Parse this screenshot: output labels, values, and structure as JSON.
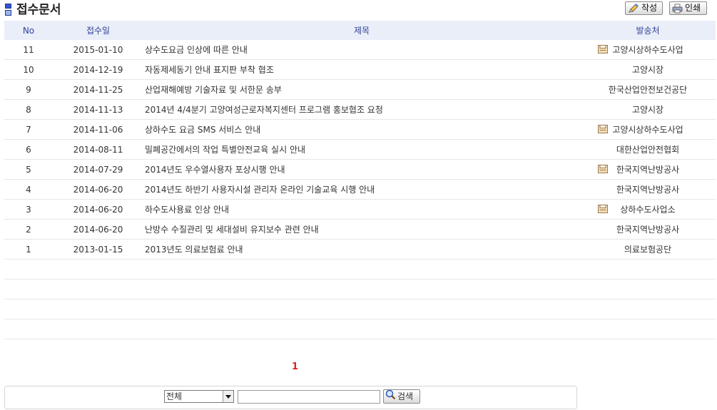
{
  "header": {
    "title": "접수문서",
    "write_label": "작성",
    "print_label": "인쇄"
  },
  "table": {
    "columns": [
      "No",
      "접수일",
      "제목",
      "발송처"
    ],
    "rows": [
      {
        "no": "11",
        "date": "2015-01-10",
        "subject": "상수도요금 인상에 따른 안내",
        "sender": "고양시상하수도사업",
        "attachment": true
      },
      {
        "no": "10",
        "date": "2014-12-19",
        "subject": "자동제세동기 안내 표지판 부착 협조",
        "sender": "고양시장",
        "attachment": false
      },
      {
        "no": "9",
        "date": "2014-11-25",
        "subject": "산업재해예방 기술자료 및 서한문 송부",
        "sender": "한국산업안전보건공단",
        "attachment": false
      },
      {
        "no": "8",
        "date": "2014-11-13",
        "subject": "2014년 4/4분기 고양여성근로자복지센터 프로그램 홍보협조 요청",
        "sender": "고양시장",
        "attachment": false
      },
      {
        "no": "7",
        "date": "2014-11-06",
        "subject": "상하수도 요금 SMS 서비스 안내",
        "sender": "고양시상하수도사업",
        "attachment": true
      },
      {
        "no": "6",
        "date": "2014-08-11",
        "subject": "밀폐공간에서의 작업 특별안전교육 실시 안내",
        "sender": "대한산업안전협회",
        "attachment": false
      },
      {
        "no": "5",
        "date": "2014-07-29",
        "subject": "2014년도 우수열사용자 포상시행 안내",
        "sender": "한국지역난방공사",
        "attachment": true
      },
      {
        "no": "4",
        "date": "2014-06-20",
        "subject": "2014년도 하반기 사용자시설 관리자 온라인 기술교육 시행 안내",
        "sender": "한국지역난방공사",
        "attachment": false
      },
      {
        "no": "3",
        "date": "2014-06-20",
        "subject": "하수도사용료 인상 안내",
        "sender": "상하수도사업소",
        "attachment": true
      },
      {
        "no": "2",
        "date": "2014-06-20",
        "subject": "난방수 수질관리 및 세대설비 유지보수 관련 안내",
        "sender": "한국지역난방공사",
        "attachment": false
      },
      {
        "no": "1",
        "date": "2013-01-15",
        "subject": "2013년도 의료보험료 안내",
        "sender": "의료보험공단",
        "attachment": false
      }
    ],
    "empty_rows": 4
  },
  "pagination": {
    "current_page": "1"
  },
  "search": {
    "scope_selected": "전체",
    "query_value": "",
    "button_label": "검색"
  },
  "colors": {
    "header_bg": "#e9eef8",
    "header_text": "#30429a",
    "current_page": "#e02020",
    "title_mark": "#3355cc"
  },
  "icons": {
    "title": "document-marker-icon",
    "write": "pencil-icon",
    "print": "printer-icon",
    "attachment": "attachment-icon",
    "search": "magnifier-icon"
  }
}
